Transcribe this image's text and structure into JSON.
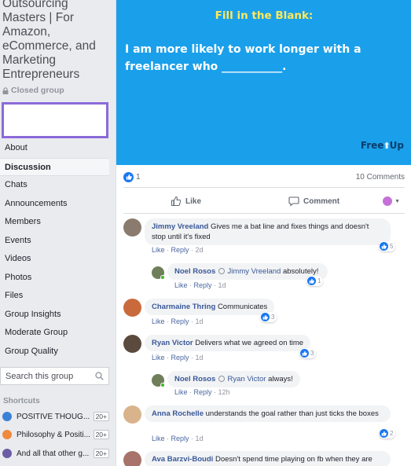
{
  "group": {
    "title": "Outsourcing Masters | For Amazon, eCommerce, and Marketing Entrepreneurs",
    "privacy": "Closed group"
  },
  "nav": {
    "items": [
      "About",
      "Discussion",
      "Chats",
      "Announcements",
      "Members",
      "Events",
      "Videos",
      "Photos",
      "Files",
      "Group Insights",
      "Moderate Group",
      "Group Quality"
    ],
    "active": "Discussion"
  },
  "search": {
    "placeholder": "Search this group"
  },
  "shortcuts": {
    "label": "Shortcuts",
    "items": [
      {
        "label": "POSITIVE THOUG...",
        "badge": "20+",
        "icon_color": "#3b82d6"
      },
      {
        "label": "Philosophy & Positi...",
        "badge": "20+",
        "icon_color": "#f08a3c"
      },
      {
        "label": "And all that other g...",
        "badge": "20+",
        "icon_color": "#6b5ca5"
      }
    ]
  },
  "post": {
    "banner": {
      "heading": "Fill in the Blank:",
      "body": "I am more likely to work longer with a freelancer who ___________.",
      "logo_left": "Free",
      "logo_right": "Up",
      "bg_color": "#1aa0ea",
      "heading_color": "#ffe95a"
    },
    "like_count": "1",
    "comment_count": "10 Comments",
    "actions": {
      "like": "Like",
      "comment": "Comment"
    }
  },
  "comments": [
    {
      "author": "Jimmy Vreeland",
      "text": "Gives me a bat line and fixes things and doesn't stop until it's fixed",
      "like": "Like",
      "reply": "Reply",
      "time": "2d",
      "reactions": "5",
      "avatar_color": "#8a7b6e"
    },
    {
      "author": "Noel Rosos",
      "tag": "Jimmy Vreeland",
      "text": "absolutely!",
      "like": "Like",
      "reply": "Reply",
      "time": "1d",
      "reactions": "1",
      "avatar_color": "#6e7f5a"
    },
    {
      "author": "Charmaine Thring",
      "text": "Communicates",
      "like": "Like",
      "reply": "Reply",
      "time": "1d",
      "reactions": "3",
      "avatar_color": "#c96a3d"
    },
    {
      "author": "Ryan Victor",
      "text": "Delivers what we agreed on time",
      "like": "Like",
      "reply": "Reply",
      "time": "1d",
      "reactions": "3",
      "avatar_color": "#5b4a3e"
    },
    {
      "author": "Noel Rosos",
      "tag": "Ryan Victor",
      "text": "always!",
      "like": "Like",
      "reply": "Reply",
      "time": "12h",
      "avatar_color": "#6e7f5a"
    },
    {
      "author": "Anna Rochelle",
      "text": "understands the goal rather than just ticks the boxes",
      "like": "Like",
      "reply": "Reply",
      "time": "1d",
      "reactions": "2",
      "avatar_color": "#d9b38c"
    },
    {
      "author": "Ava Barzvi-Boudi",
      "text": "Doesn't spend time playing on fb when they are",
      "avatar_color": "#a8736a"
    }
  ]
}
